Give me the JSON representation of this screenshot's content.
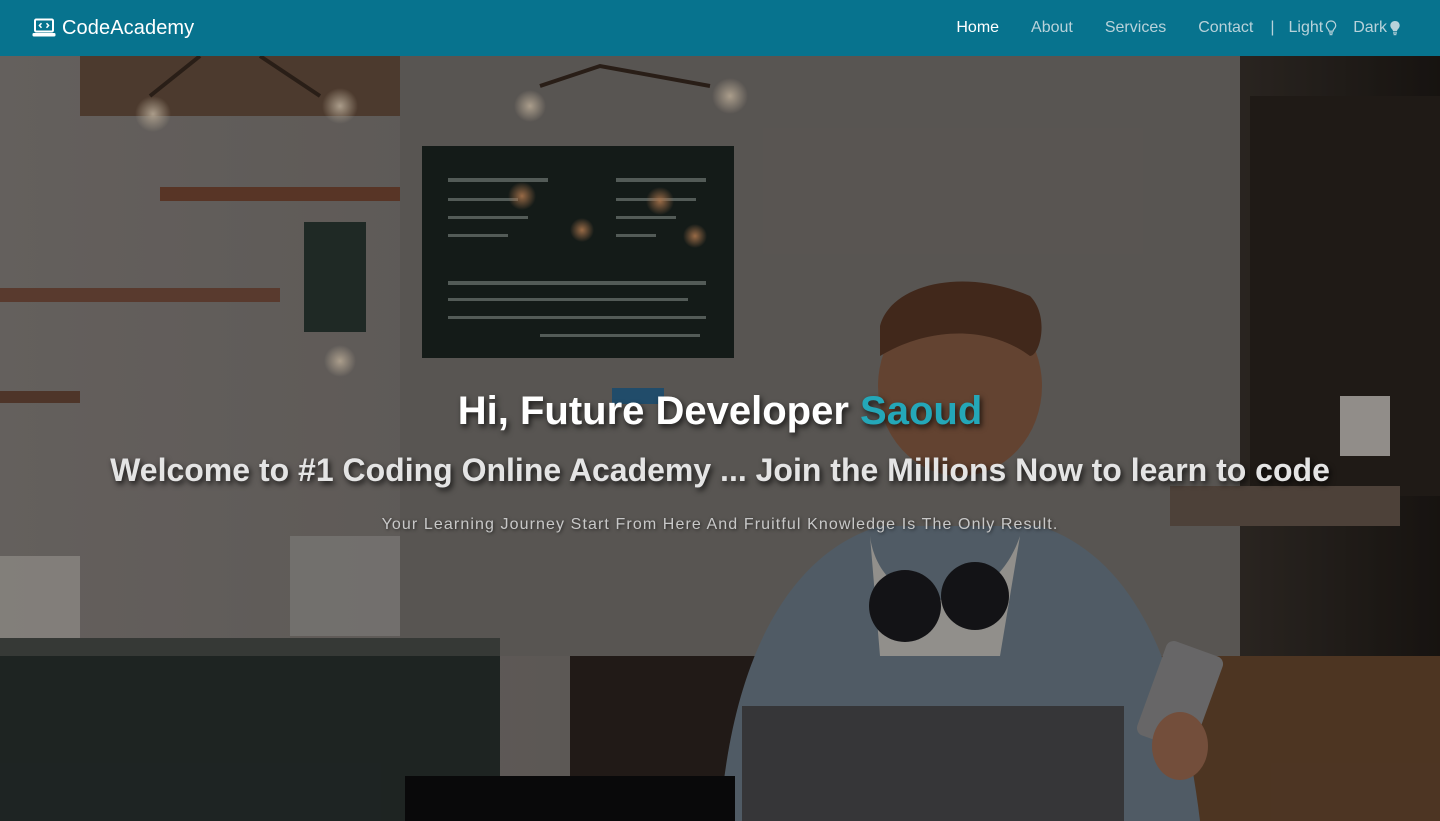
{
  "brand": {
    "name": "CodeAcademy",
    "icon": "laptop-code-icon"
  },
  "nav": {
    "links": [
      "Home",
      "About",
      "Services",
      "Contact"
    ],
    "active": "Home",
    "separator": "|",
    "theme_light": "Light",
    "theme_dark": "Dark",
    "theme_light_icon": "lightbulb-outline-icon",
    "theme_dark_icon": "lightbulb-filled-icon"
  },
  "hero": {
    "title_prefix": "Hi, Future Developer",
    "title_name": "Saoud",
    "subtitle": "Welcome to #1 Coding Online Academy ... Join the Millions Now to learn to code",
    "tagline": "Your Learning Journey Start From Here And Fruitful Knowledge Is The Only Result.",
    "background": "coffee-shop-developer-photo"
  },
  "colors": {
    "navbar": "#07738e",
    "accent": "#24a7b8",
    "nav_link": "#b8d2da",
    "nav_active": "#ffffff"
  }
}
